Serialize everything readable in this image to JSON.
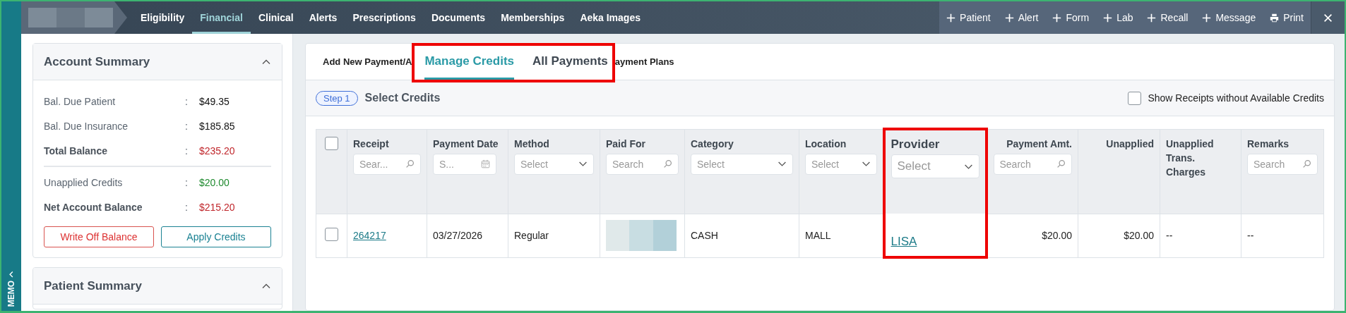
{
  "memo": {
    "label": "MEMO"
  },
  "nav": {
    "tabs": [
      {
        "label": "Eligibility",
        "selected": false
      },
      {
        "label": "Financial",
        "selected": true
      },
      {
        "label": "Clinical",
        "selected": false
      },
      {
        "label": "Alerts",
        "selected": false
      },
      {
        "label": "Prescriptions",
        "selected": false
      },
      {
        "label": "Documents",
        "selected": false
      },
      {
        "label": "Memberships",
        "selected": false
      },
      {
        "label": "Aeka Images",
        "selected": false
      }
    ],
    "actions": [
      {
        "label": "Patient",
        "kind": "add"
      },
      {
        "label": "Alert",
        "kind": "add"
      },
      {
        "label": "Form",
        "kind": "add"
      },
      {
        "label": "Lab",
        "kind": "add"
      },
      {
        "label": "Recall",
        "kind": "add"
      },
      {
        "label": "Message",
        "kind": "add"
      },
      {
        "label": "Print",
        "kind": "print"
      }
    ]
  },
  "account_summary": {
    "title": "Account Summary",
    "expanded": true,
    "groups": [
      [
        {
          "label": "Bal. Due Patient",
          "separator": ":",
          "value": "$49.35",
          "emphasis": false,
          "color": "#111111"
        },
        {
          "label": "Bal. Due Insurance",
          "separator": ":",
          "value": "$185.85",
          "emphasis": false,
          "color": "#111111"
        },
        {
          "label": "Total Balance",
          "separator": ":",
          "value": "$235.20",
          "emphasis": true,
          "color": "#c0262b"
        }
      ],
      [
        {
          "label": "Unapplied Credits",
          "separator": ":",
          "value": "$20.00",
          "emphasis": false,
          "color": "#1e8a2e"
        },
        {
          "label": "Net Account Balance",
          "separator": ":",
          "value": "$215.20",
          "emphasis": true,
          "color": "#c0262b"
        }
      ]
    ],
    "buttons": [
      {
        "label": "Write Off Balance",
        "kind": "danger"
      },
      {
        "label": "Apply Credits",
        "kind": "primary"
      }
    ]
  },
  "patient_summary": {
    "title": "Patient Summary",
    "expanded": true
  },
  "payments": {
    "tabs": [
      {
        "label": "Add New Payment/A",
        "selected": false,
        "annotated": false
      },
      {
        "label": "Manage Credits",
        "selected": true,
        "annotated": true
      },
      {
        "label": "All Payments",
        "selected": false,
        "annotated": true
      },
      {
        "label": "ayment Plans",
        "selected": false,
        "annotated": false
      }
    ],
    "step": {
      "badge": "Step 1",
      "title": "Select Credits"
    },
    "show_receipts": {
      "label": "Show Receipts without Available Credits",
      "checked": false
    },
    "table": {
      "select_all": false,
      "columns": [
        {
          "label": "Receipt",
          "filter": {
            "kind": "search",
            "placeholder": "Sear..."
          },
          "annotated": false
        },
        {
          "label": "Payment Date",
          "filter": {
            "kind": "date",
            "placeholder": "S..."
          },
          "annotated": false
        },
        {
          "label": "Method",
          "filter": {
            "kind": "select",
            "placeholder": "Select"
          },
          "annotated": false
        },
        {
          "label": "Paid For",
          "filter": {
            "kind": "search",
            "placeholder": "Search"
          },
          "annotated": false
        },
        {
          "label": "Category",
          "filter": {
            "kind": "select",
            "placeholder": "Select"
          },
          "annotated": false
        },
        {
          "label": "Location",
          "filter": {
            "kind": "select",
            "placeholder": "Select"
          },
          "annotated": false
        },
        {
          "label": "Provider",
          "filter": {
            "kind": "select",
            "placeholder": "Select"
          },
          "annotated": true
        },
        {
          "label": "Payment Amt.",
          "filter": {
            "kind": "search",
            "placeholder": "Search"
          },
          "annotated": false
        },
        {
          "label": "Unapplied",
          "annotated": false
        },
        {
          "label": "Unapplied Trans. Charges",
          "annotated": false
        },
        {
          "label": "Remarks",
          "filter": {
            "kind": "search",
            "placeholder": "Search"
          },
          "annotated": false
        }
      ],
      "rows": [
        {
          "selected": false,
          "cells": [
            {
              "kind": "link",
              "text": "264217"
            },
            {
              "kind": "text",
              "text": "03/27/2026"
            },
            {
              "kind": "text",
              "text": "Regular"
            },
            {
              "kind": "redacted"
            },
            {
              "kind": "text",
              "text": "CASH"
            },
            {
              "kind": "text",
              "text": "MALL"
            },
            {
              "kind": "link",
              "text": "LISA"
            },
            {
              "kind": "text",
              "text": "$20.00"
            },
            {
              "kind": "text",
              "text": "$20.00"
            },
            {
              "kind": "text",
              "text": "--"
            },
            {
              "kind": "text",
              "text": "--"
            }
          ]
        }
      ]
    }
  }
}
